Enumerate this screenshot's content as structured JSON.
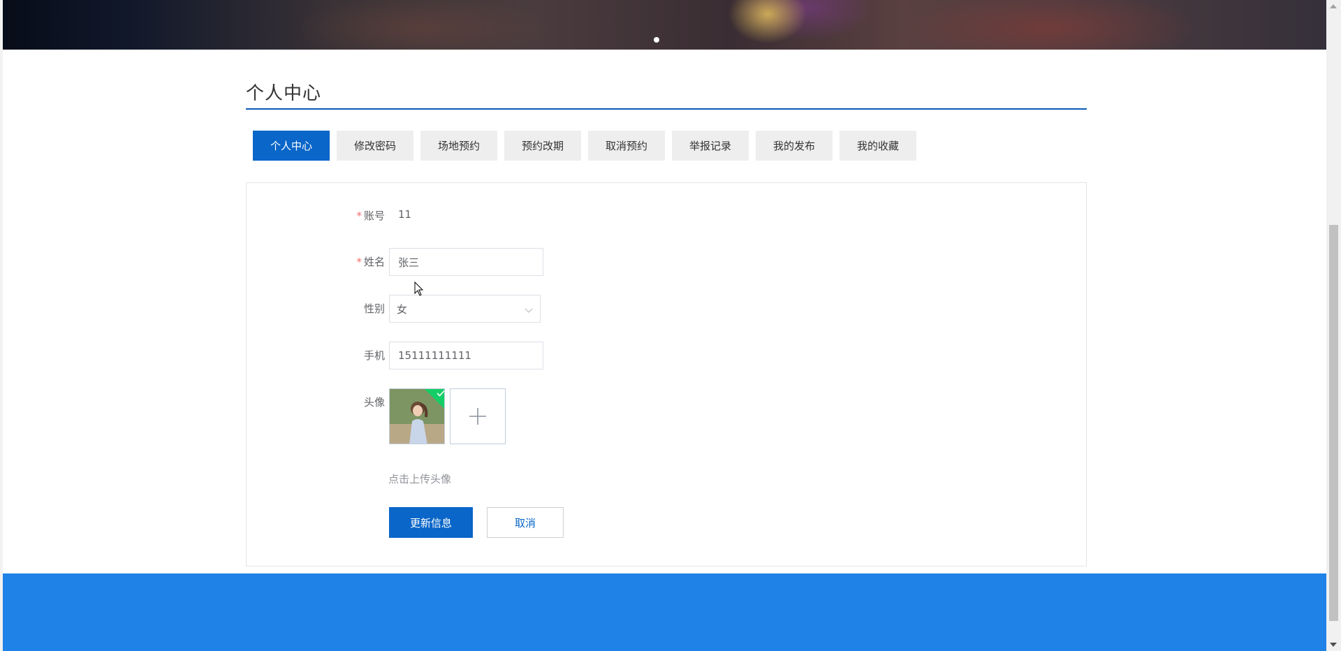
{
  "header": {
    "title": "个人中心"
  },
  "tabs": [
    {
      "label": "个人中心",
      "active": true
    },
    {
      "label": "修改密码",
      "active": false
    },
    {
      "label": "场地预约",
      "active": false
    },
    {
      "label": "预约改期",
      "active": false
    },
    {
      "label": "取消预约",
      "active": false
    },
    {
      "label": "举报记录",
      "active": false
    },
    {
      "label": "我的发布",
      "active": false
    },
    {
      "label": "我的收藏",
      "active": false
    }
  ],
  "form": {
    "account": {
      "label": "账号",
      "required": true,
      "value": "11"
    },
    "name": {
      "label": "姓名",
      "required": true,
      "value": "张三"
    },
    "gender": {
      "label": "性别",
      "value": "女"
    },
    "phone": {
      "label": "手机",
      "value": "15111111111"
    },
    "avatar": {
      "label": "头像",
      "hint": "点击上传头像"
    },
    "required_mark": "*",
    "submit_label": "更新信息",
    "cancel_label": "取消"
  },
  "colors": {
    "primary": "#0a66c8",
    "footer": "#1f82e6",
    "success": "#13ce66",
    "required": "#f56c6c"
  },
  "icons": {
    "select": "chevron-down-icon",
    "upload": "plus-icon",
    "uploaded": "check-icon"
  }
}
